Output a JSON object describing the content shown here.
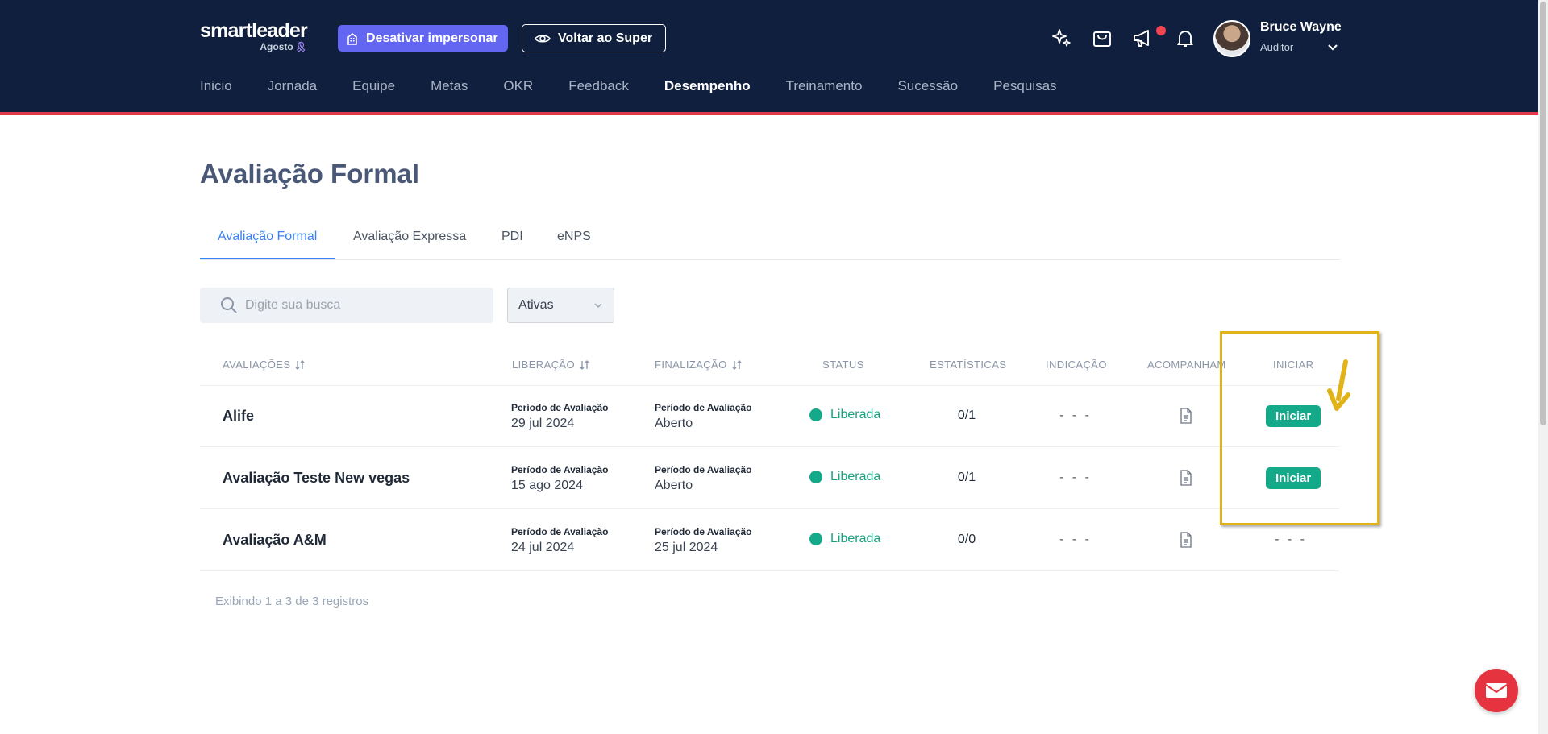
{
  "header": {
    "logo_name": "smartleader",
    "logo_sub": "Agosto",
    "btn_impersonar": "Desativar impersonar",
    "btn_voltar": "Voltar ao Super",
    "user_name": "Bruce Wayne",
    "user_role": "Auditor"
  },
  "nav": {
    "items": [
      "Inicio",
      "Jornada",
      "Equipe",
      "Metas",
      "OKR",
      "Feedback",
      "Desempenho",
      "Treinamento",
      "Sucessão",
      "Pesquisas"
    ],
    "active": "Desempenho"
  },
  "page": {
    "title": "Avaliação Formal",
    "tabs": [
      "Avaliação Formal",
      "Avaliação Expressa",
      "PDI",
      "eNPS"
    ],
    "active_tab": "Avaliação Formal"
  },
  "filters": {
    "search_placeholder": "Digite sua busca",
    "select_value": "Ativas"
  },
  "table": {
    "headers": {
      "avaliacoes": "AVALIAÇÕES",
      "liberacao": "LIBERAÇÃO",
      "finalizacao": "FINALIZAÇÃO",
      "status": "STATUS",
      "estatisticas": "ESTATÍSTICAS",
      "indicacao": "INDICAÇÃO",
      "acompanhamento": "ACOMPANHAM",
      "iniciar": "INICIAR"
    },
    "rows": [
      {
        "name": "Alife",
        "lib_label": "Período de Avaliação",
        "lib_value": "29 jul 2024",
        "fin_label": "Período de Avaliação",
        "fin_value": "Aberto",
        "status": "Liberada",
        "stats": "0/1",
        "indicacao": "- - -",
        "iniciar": "Iniciar"
      },
      {
        "name": "Avaliação Teste New vegas",
        "lib_label": "Período de Avaliação",
        "lib_value": "15 ago 2024",
        "fin_label": "Período de Avaliação",
        "fin_value": "Aberto",
        "status": "Liberada",
        "stats": "0/1",
        "indicacao": "- - -",
        "iniciar": "Iniciar"
      },
      {
        "name": "Avaliação A&M",
        "lib_label": "Período de Avaliação",
        "lib_value": "24 jul 2024",
        "fin_label": "Período de Avaliação",
        "fin_value": "25 jul 2024",
        "status": "Liberada",
        "stats": "0/0",
        "indicacao": "- - -",
        "iniciar": "- - -"
      }
    ],
    "footer": "Exibindo 1 a 3 de 3 registros"
  },
  "colors": {
    "header_bg": "#0f1f3d",
    "accent_red": "#e33a4f",
    "primary_blue": "#3b82f6",
    "success_green": "#14a989",
    "impersonar_purple": "#6366f1",
    "highlight_yellow": "#e2b318"
  }
}
